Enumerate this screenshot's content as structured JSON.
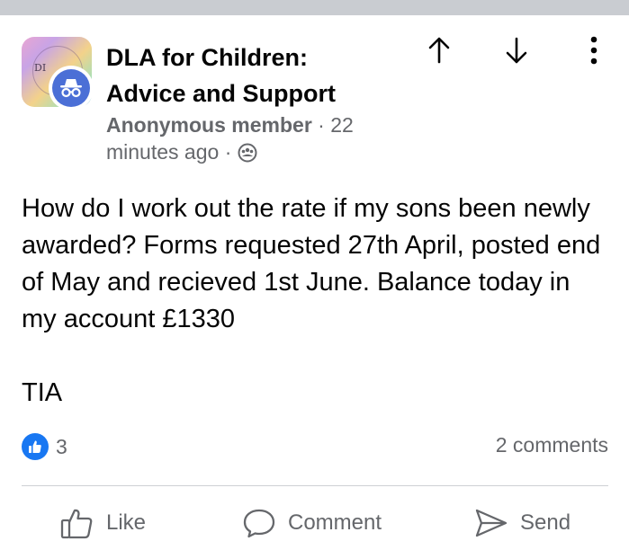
{
  "group": {
    "name_line1": "DLA for Children:",
    "name_line2": "Advice and Support",
    "avatar_text": "DI"
  },
  "post": {
    "author": "Anonymous member",
    "timestamp_part1": "22",
    "timestamp_part2": "minutes ago",
    "separator": "·",
    "body_paragraph": "How do I work out the rate if my sons been newly awarded? Forms requested 27th April, posted end of May and recieved 1st June. Balance today in my account £1330",
    "body_signoff": "TIA"
  },
  "engagement": {
    "reaction_count": "3",
    "comments_label": "2 comments"
  },
  "actions": {
    "like_label": "Like",
    "comment_label": "Comment",
    "send_label": "Send"
  },
  "icons": {
    "upvote": "arrow-up-icon",
    "downvote": "arrow-down-icon",
    "more": "more-vertical-icon",
    "privacy": "group-privacy-icon",
    "anonymous": "anonymous-incognito-icon",
    "like_reaction": "thumbs-up-reaction-icon",
    "like": "thumbs-up-outline-icon",
    "comment": "comment-bubble-icon",
    "send": "send-arrow-icon"
  },
  "colors": {
    "brand_blue": "#1877f2",
    "secondary_text": "#65676b",
    "primary_text": "#050505",
    "divider": "#ced0d4",
    "anonymous_badge": "#4b6fd6"
  }
}
